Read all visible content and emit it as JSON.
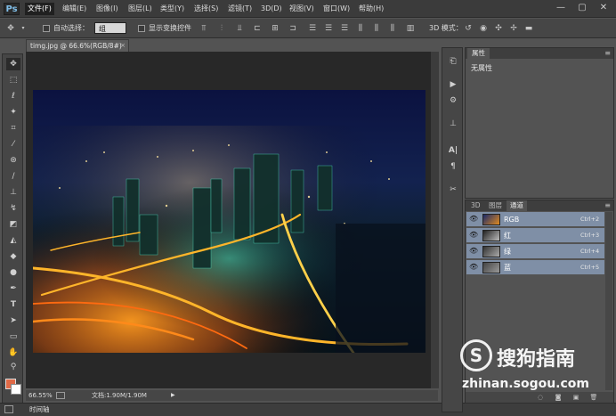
{
  "app": {
    "logo": "Ps"
  },
  "menu": {
    "items": [
      "文件(F)",
      "编辑(E)",
      "图像(I)",
      "图层(L)",
      "类型(Y)",
      "选择(S)",
      "滤镜(T)",
      "3D(D)",
      "视图(V)",
      "窗口(W)",
      "帮助(H)"
    ],
    "active_index": 0
  },
  "window_controls": {
    "minimize": "—",
    "restore": "▢",
    "close": "✕"
  },
  "options": {
    "auto_select_label": "自动选择：",
    "auto_select_value": "组",
    "show_transform_label": "显示变换控件",
    "mode_label": "3D 模式："
  },
  "document": {
    "tab_title": "timg.jpg @ 66.6%(RGB/8#)",
    "close": "×"
  },
  "status": {
    "zoom": "66.55%",
    "doc_info": "文档:1.90M/1.90M"
  },
  "timeline": {
    "label": "时间轴"
  },
  "properties": {
    "tab": "属性",
    "empty_text": "无属性"
  },
  "channels": {
    "tabs": [
      "3D",
      "图层",
      "通道"
    ],
    "active_tab": 2,
    "rows": [
      {
        "name": "RGB",
        "shortcut": "Ctrl+2"
      },
      {
        "name": "红",
        "shortcut": "Ctrl+3"
      },
      {
        "name": "绿",
        "shortcut": "Ctrl+4"
      },
      {
        "name": "蓝",
        "shortcut": "Ctrl+5"
      }
    ]
  },
  "watermark": {
    "symbol": "S",
    "brand": "搜狗指南",
    "url": "zhinan.sogou.com"
  },
  "icons": {
    "tools": [
      "move-icon",
      "marquee-icon",
      "lasso-icon",
      "magic-wand-icon",
      "crop-icon",
      "eyedropper-icon",
      "healing-icon",
      "brush-icon",
      "stamp-icon",
      "history-brush-icon",
      "eraser-icon",
      "gradient-icon",
      "blur-icon",
      "dodge-icon",
      "pen-icon",
      "type-icon",
      "path-select-icon",
      "rectangle-icon",
      "hand-icon",
      "zoom-icon"
    ],
    "mid": [
      "history-icon",
      "actions-icon",
      "adjust-icon",
      "stamp-panel-icon",
      "character-icon",
      "paragraph-icon",
      "tools-preset-icon"
    ]
  },
  "colors": {
    "foreground": "#e06a47",
    "background": "#ffffff",
    "channel_highlight": "#7f8fa6"
  }
}
